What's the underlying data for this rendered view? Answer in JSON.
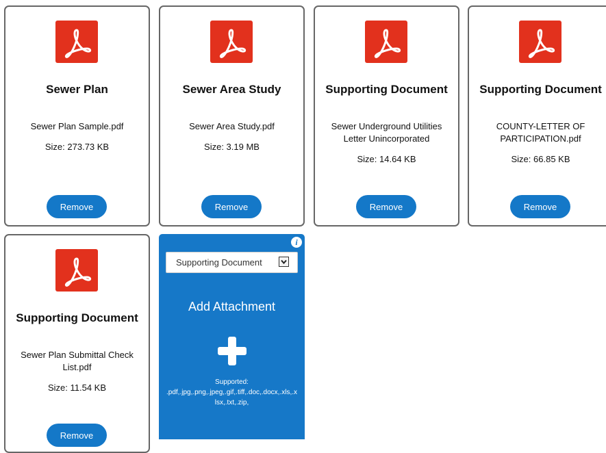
{
  "attachments": [
    {
      "title": "Sewer Plan",
      "file_name": "Sewer Plan Sample.pdf",
      "size": "Size: 273.73 KB",
      "remove_label": "Remove",
      "icon": "pdf-icon"
    },
    {
      "title": "Sewer Area Study",
      "file_name": "Sewer Area Study.pdf",
      "size": "Size: 3.19 MB",
      "remove_label": "Remove",
      "icon": "pdf-icon"
    },
    {
      "title": "Supporting Document",
      "file_name": "Sewer Underground Utilities Letter Unincorporated",
      "size": "Size: 14.64 KB",
      "remove_label": "Remove",
      "icon": "pdf-icon"
    },
    {
      "title": "Supporting Document",
      "file_name": "COUNTY-LETTER OF PARTICIPATION.pdf",
      "size": "Size: 66.85 KB",
      "remove_label": "Remove",
      "icon": "pdf-icon"
    },
    {
      "title": "Supporting Document",
      "file_name": "Sewer Plan Submittal Check List.pdf",
      "size": "Size: 11.54 KB",
      "remove_label": "Remove",
      "icon": "pdf-icon"
    }
  ],
  "add_card": {
    "selected_type": "Supporting Document",
    "title": "Add Attachment",
    "supported_label": "Supported:",
    "supported_types": ".pdf,.jpg,.png,.jpeg,.gif,.tiff,.doc,.docx,.xls,.xlsx,.txt,.zip,",
    "info_icon": "info-icon",
    "add_icon": "plus-icon"
  },
  "colors": {
    "accent": "#1478c8",
    "add_card_bg": "#1678c8",
    "pdf_red": "#e2311d",
    "card_border": "#666666"
  }
}
